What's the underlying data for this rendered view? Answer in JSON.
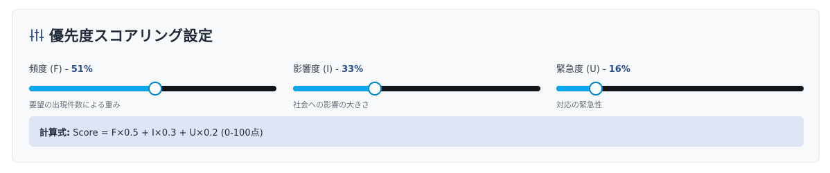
{
  "header": {
    "title": "優先度スコアリング設定",
    "icon": "sliders-icon"
  },
  "sliders": [
    {
      "name": "頻度 (F)",
      "separator": " - ",
      "percent_label": "51%",
      "value": 51,
      "description": "要望の出現件数による重み"
    },
    {
      "name": "影響度 (I)",
      "separator": " - ",
      "percent_label": "33%",
      "value": 33,
      "description": "社会への影響の大きさ"
    },
    {
      "name": "緊急度 (U)",
      "separator": " - ",
      "percent_label": "16%",
      "value": 16,
      "description": "対応の緊急性"
    }
  ],
  "formula": {
    "label": "計算式:",
    "text": "Score = F×0.5 + I×0.3 + U×0.2 (0-100点)"
  },
  "colors": {
    "accent": "#0ea5e9",
    "track": "#111418",
    "percent_text": "#2b4c8c",
    "formula_bg": "#e0e5f5",
    "card_bg": "#f8f9fa"
  }
}
